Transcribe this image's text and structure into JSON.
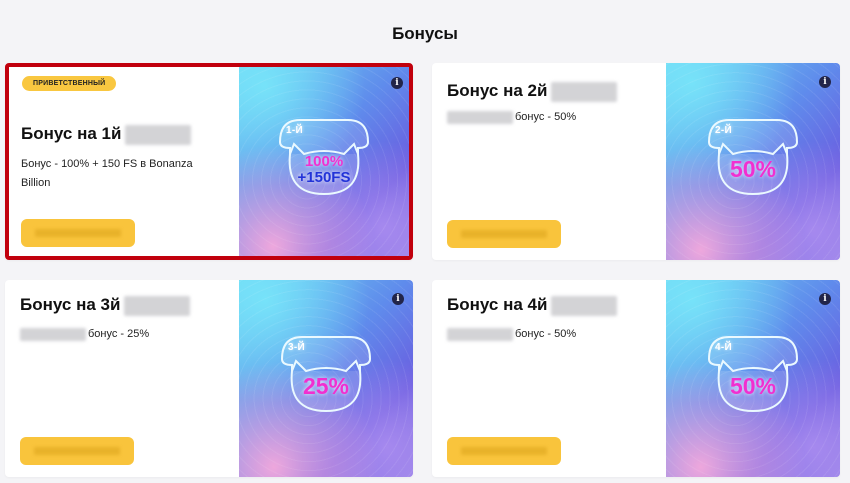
{
  "page": {
    "title": "Бонусы"
  },
  "colors": {
    "accent": "#f9c43c",
    "highlight_border": "#c1000d",
    "percent": "#f12fd0",
    "fs": "#2233d8"
  },
  "icons": {
    "info": "info-icon",
    "badge_shape": "cat-icon"
  },
  "cards": [
    {
      "badge": "ПРИВЕТСТВЕННЫЙ",
      "title": "Бонус на 1й",
      "description": "Бонус - 100% + 150 FS в Bonanza Billion",
      "image": {
        "rank": "1-Й",
        "percent": "100%",
        "extra": "+150FS"
      },
      "info_icon": "i"
    },
    {
      "title": "Бонус на 2й",
      "description": "бонус - 50%",
      "image": {
        "rank": "2-Й",
        "percent": "50%"
      },
      "info_icon": "i"
    },
    {
      "title": "Бонус на 3й",
      "description": "бонус - 25%",
      "image": {
        "rank": "3-Й",
        "percent": "25%"
      },
      "info_icon": "i"
    },
    {
      "title": "Бонус на 4й",
      "description": "бонус - 50%",
      "image": {
        "rank": "4-Й",
        "percent": "50%"
      },
      "info_icon": "i"
    }
  ]
}
